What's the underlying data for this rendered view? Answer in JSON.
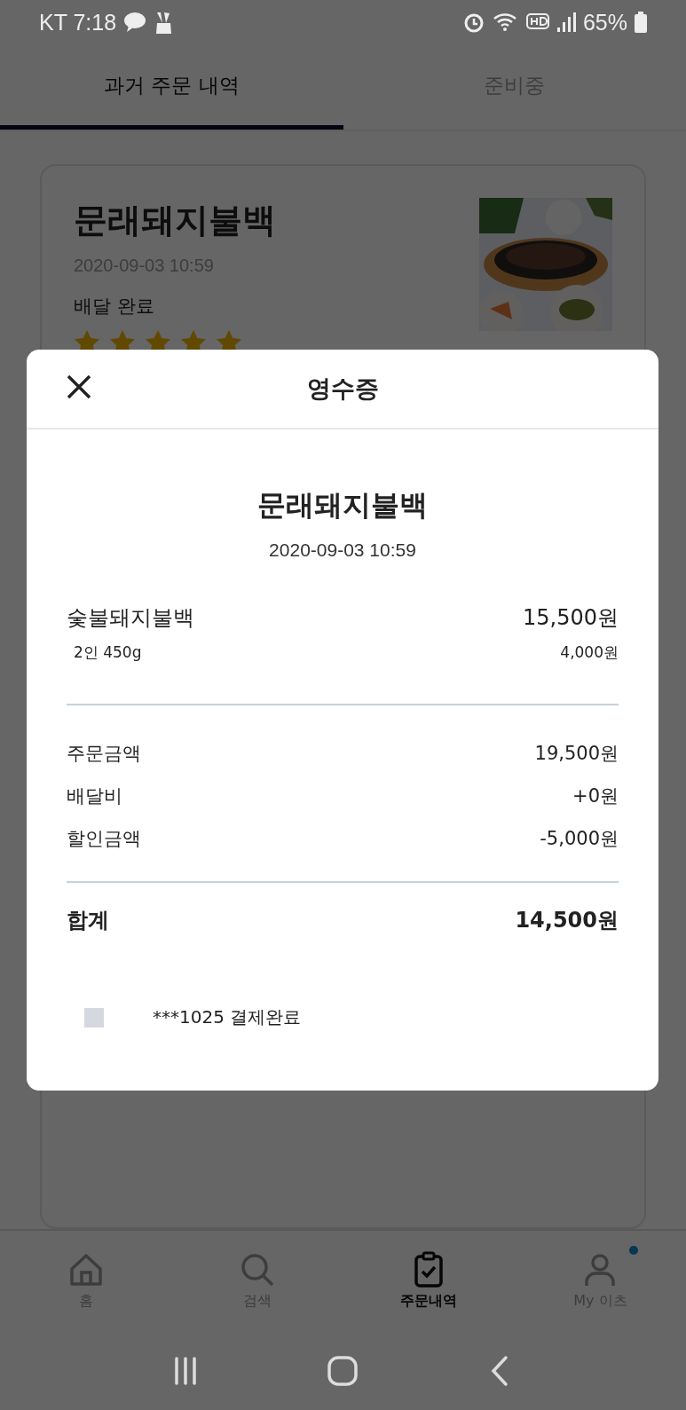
{
  "status_bar": {
    "carrier_time": "KT 7:18",
    "battery": "65%"
  },
  "tabs": [
    {
      "label": "과거 주문 내역",
      "selected": true
    },
    {
      "label": "준비중",
      "selected": false
    }
  ],
  "order_card": {
    "title": "문래돼지불백",
    "date": "2020-09-03 10:59",
    "status": "배달 완료",
    "stars": 5
  },
  "receipt": {
    "title": "영수증",
    "store": "문래돼지불백",
    "date": "2020-09-03 10:59",
    "items": [
      {
        "name": "숯불돼지불백",
        "price": "15,500원",
        "option": "2인 450g",
        "option_price": "4,000원"
      }
    ],
    "summary": [
      {
        "label": "주문금액",
        "value": "19,500원"
      },
      {
        "label": "배달비",
        "value": "+0원"
      },
      {
        "label": "할인금액",
        "value": "-5,000원"
      }
    ],
    "total": {
      "label": "합계",
      "value": "14,500원"
    },
    "payment": "***1025 결제완료"
  },
  "bottom_nav": [
    {
      "kind": "home",
      "label": "홈",
      "selected": false,
      "badge": false
    },
    {
      "kind": "search",
      "label": "검색",
      "selected": false,
      "badge": false
    },
    {
      "kind": "orders",
      "label": "주문내역",
      "selected": true,
      "badge": false
    },
    {
      "kind": "profile",
      "label": "My 이츠",
      "selected": false,
      "badge": true
    }
  ]
}
